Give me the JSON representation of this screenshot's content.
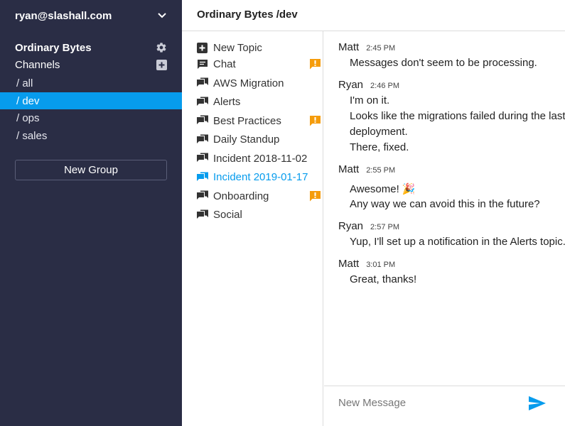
{
  "sidebar": {
    "account": "ryan@slashall.com",
    "group_name": "Ordinary Bytes",
    "channels_label": "Channels",
    "channels": [
      {
        "label": "/ all"
      },
      {
        "label": "/ dev",
        "active": true
      },
      {
        "label": "/ ops"
      },
      {
        "label": "/ sales"
      }
    ],
    "new_group_label": "New Group"
  },
  "header": {
    "title": "Ordinary Bytes /dev"
  },
  "topics": {
    "new_topic_label": "New Topic",
    "items": [
      {
        "label": "Chat",
        "unread": true
      },
      {
        "label": "AWS Migration",
        "unread": false
      },
      {
        "label": "Alerts",
        "unread": false
      },
      {
        "label": "Best Practices",
        "unread": true
      },
      {
        "label": "Daily Standup",
        "unread": false
      },
      {
        "label": "Incident 2018-11-02",
        "unread": false
      },
      {
        "label": "Incident 2019-01-17",
        "unread": false,
        "active": true
      },
      {
        "label": "Onboarding",
        "unread": true
      },
      {
        "label": "Social",
        "unread": false
      }
    ]
  },
  "messages": [
    {
      "author": "Matt",
      "time": "2:45 PM",
      "lines": [
        "Messages don't seem to be processing."
      ]
    },
    {
      "author": "Ryan",
      "time": "2:46 PM",
      "lines": [
        "I'm on it.",
        "Looks like the migrations failed during the last",
        "deployment.",
        "There, fixed."
      ]
    },
    {
      "author": "Matt",
      "time": "2:55 PM",
      "lines": [
        "Awesome! 🎉",
        "Any way we can avoid this in the future?"
      ]
    },
    {
      "author": "Ryan",
      "time": "2:57 PM",
      "lines": [
        "Yup, I'll set up a notification in the Alerts topic."
      ]
    },
    {
      "author": "Matt",
      "time": "3:01 PM",
      "lines": [
        "Great, thanks!"
      ]
    }
  ],
  "composer": {
    "placeholder": "New Message"
  },
  "colors": {
    "sidebar_bg": "#2a2d45",
    "accent": "#079ced",
    "unread_badge": "#f59c0b"
  },
  "icons": {
    "account_menu": "chevron-down-icon",
    "group_settings": "gear-icon",
    "add_channel": "plus-square-icon",
    "new_topic": "plus-square-icon",
    "topic": "chat-bubble-icon",
    "unread": "alert-badge-icon",
    "send": "send-icon"
  }
}
